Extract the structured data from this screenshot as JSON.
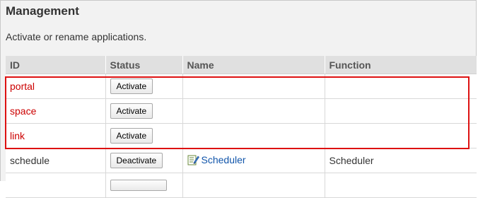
{
  "page": {
    "title": "Management",
    "description": "Activate or rename applications."
  },
  "table": {
    "headers": [
      "ID",
      "Status",
      "Name",
      "Function"
    ],
    "rows": [
      {
        "id": "portal",
        "button": "Activate",
        "name": "",
        "function": ""
      },
      {
        "id": "space",
        "button": "Activate",
        "name": "",
        "function": ""
      },
      {
        "id": "link",
        "button": "Activate",
        "name": "",
        "function": ""
      },
      {
        "id": "schedule",
        "button": "Deactivate",
        "name": "Scheduler",
        "function": "Scheduler",
        "icon": "edit-note-icon"
      },
      {
        "id": "",
        "button": "",
        "name": "",
        "function": ""
      }
    ]
  },
  "highlight": {
    "color": "#dd1111",
    "rows": [
      "portal",
      "space",
      "link"
    ]
  },
  "colors": {
    "highlight_text": "#cc0000",
    "link": "#1155aa",
    "header_bg": "#e0e0e0"
  }
}
